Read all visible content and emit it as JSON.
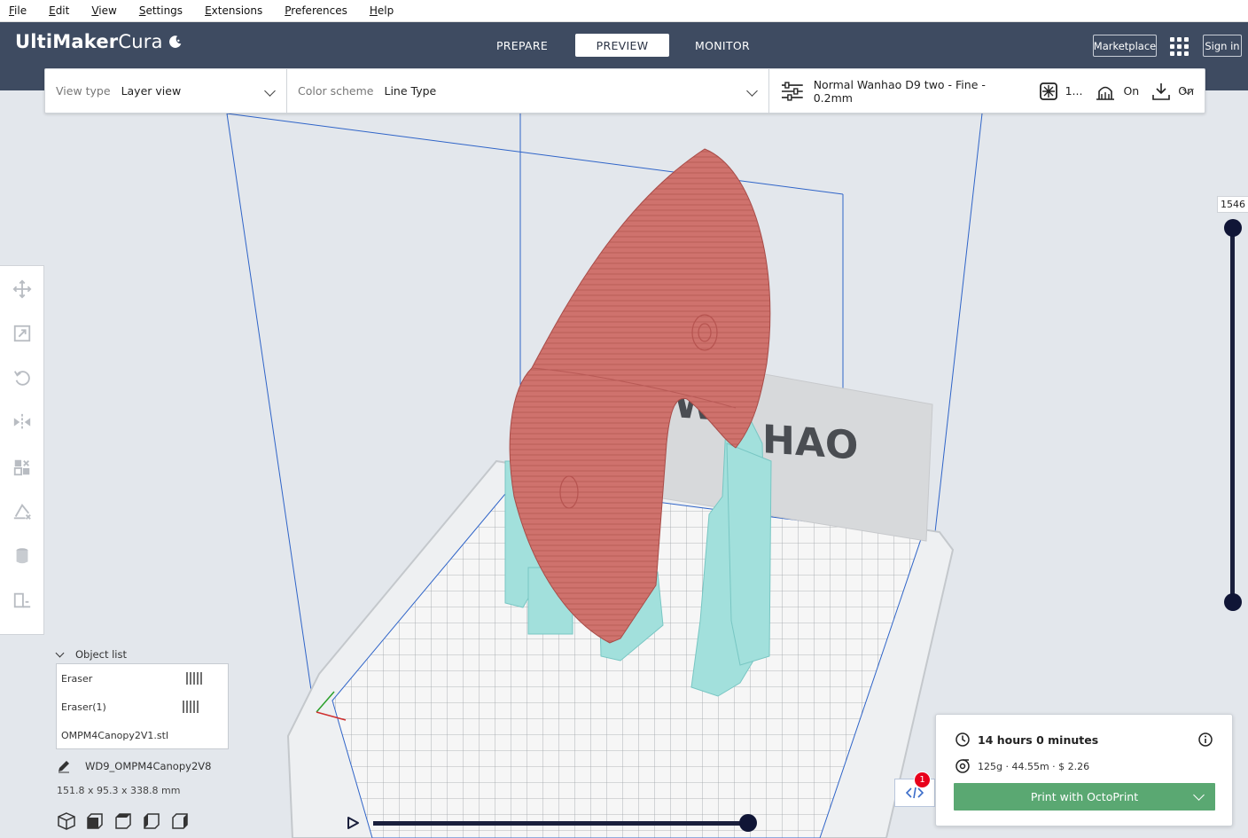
{
  "menu": [
    {
      "label": "File",
      "mnemonic": "F",
      "rest": "ile"
    },
    {
      "label": "Edit",
      "mnemonic": "E",
      "rest": "dit"
    },
    {
      "label": "View",
      "mnemonic": "V",
      "rest": "iew"
    },
    {
      "label": "Settings",
      "mnemonic": "S",
      "rest": "ettings"
    },
    {
      "label": "Extensions",
      "mnemonic": "E",
      "rest": "xtensions"
    },
    {
      "label": "Preferences",
      "mnemonic": "P",
      "rest": "references"
    },
    {
      "label": "Help",
      "mnemonic": "H",
      "rest": "elp"
    }
  ],
  "header": {
    "logo_bold": "UltiMaker",
    "logo_light": "Cura",
    "stages": [
      "PREPARE",
      "PREVIEW",
      "MONITOR"
    ],
    "active_stage": "PREVIEW",
    "marketplace": "Marketplace",
    "sign_in": "Sign in"
  },
  "toolbar": {
    "view_type_label": "View type",
    "view_type_value": "Layer view",
    "color_scheme_label": "Color scheme",
    "color_scheme_value": "Line Type",
    "profile": "Normal Wanhao D9 two - Fine - 0.2mm",
    "infill": "1...",
    "support": "On",
    "adhesion": "On"
  },
  "layer_slider": {
    "current_layer": "1546"
  },
  "object_list": {
    "title": "Object list",
    "items": [
      "Eraser",
      "Eraser(1)",
      "OMPM4Canopy2V1.stl"
    ],
    "selected_name": "WD9_OMPM4Canopy2V8",
    "dimensions": "151.8 x 95.3 x 338.8 mm"
  },
  "viewport": {
    "plate_logo": "HAO",
    "plate_logo_partial": "WA"
  },
  "output": {
    "print_time": "14 hours 0 minutes",
    "material": "125g · 44.55m · $ 2.26",
    "print_button": "Print with OctoPrint",
    "notification_count": "1"
  },
  "colors": {
    "header_bg": "#3e4b61",
    "model_shell": "#cd6f6a",
    "support": "#9fdedb",
    "print_button": "#5aa872",
    "slider": "#101536"
  }
}
